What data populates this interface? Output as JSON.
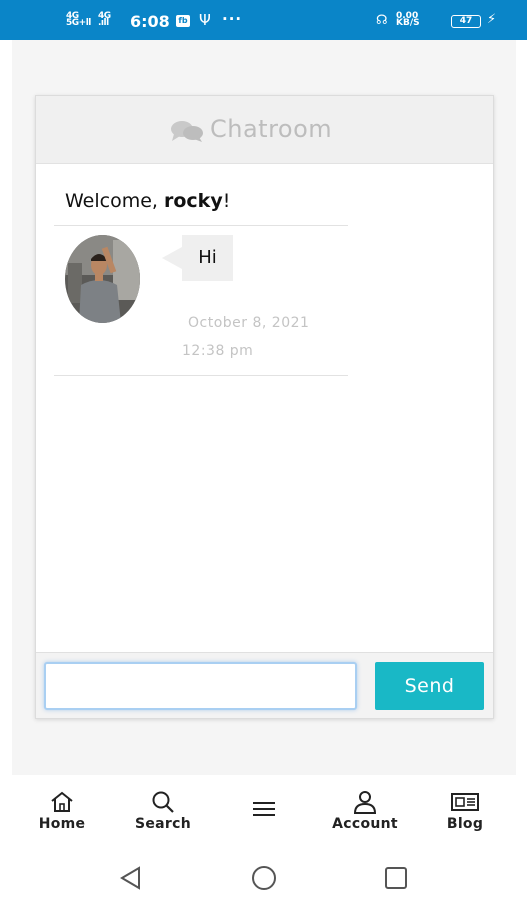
{
  "status_bar": {
    "network1": "4G\n5G+ll",
    "network2": "4G\n.ıll",
    "time": "6:08",
    "fb_badge": "fb",
    "usb_icon": "usb-icon",
    "more": "···",
    "speed": "0.00\nKB/S",
    "battery": "47",
    "background": "#0a85c8"
  },
  "chat": {
    "title": "Chatroom",
    "title_icon": "chat-bubbles-icon",
    "welcome_prefix": "Welcome, ",
    "username": "rocky",
    "welcome_suffix": "!",
    "messages": [
      {
        "text": "Hi",
        "date": "October 8, 2021",
        "time": "12:38 pm"
      }
    ]
  },
  "compose": {
    "value": "",
    "send_label": "Send",
    "send_color": "#19b8c6"
  },
  "bottom_nav": {
    "items": [
      {
        "label": "Home",
        "icon": "home-icon"
      },
      {
        "label": "Search",
        "icon": "search-icon"
      },
      {
        "label": "",
        "icon": "menu-icon"
      },
      {
        "label": "Account",
        "icon": "user-icon"
      },
      {
        "label": "Blog",
        "icon": "newspaper-icon"
      }
    ]
  },
  "system_nav": {
    "back": "back-icon",
    "home": "home-circle-icon",
    "recents": "recents-icon"
  }
}
